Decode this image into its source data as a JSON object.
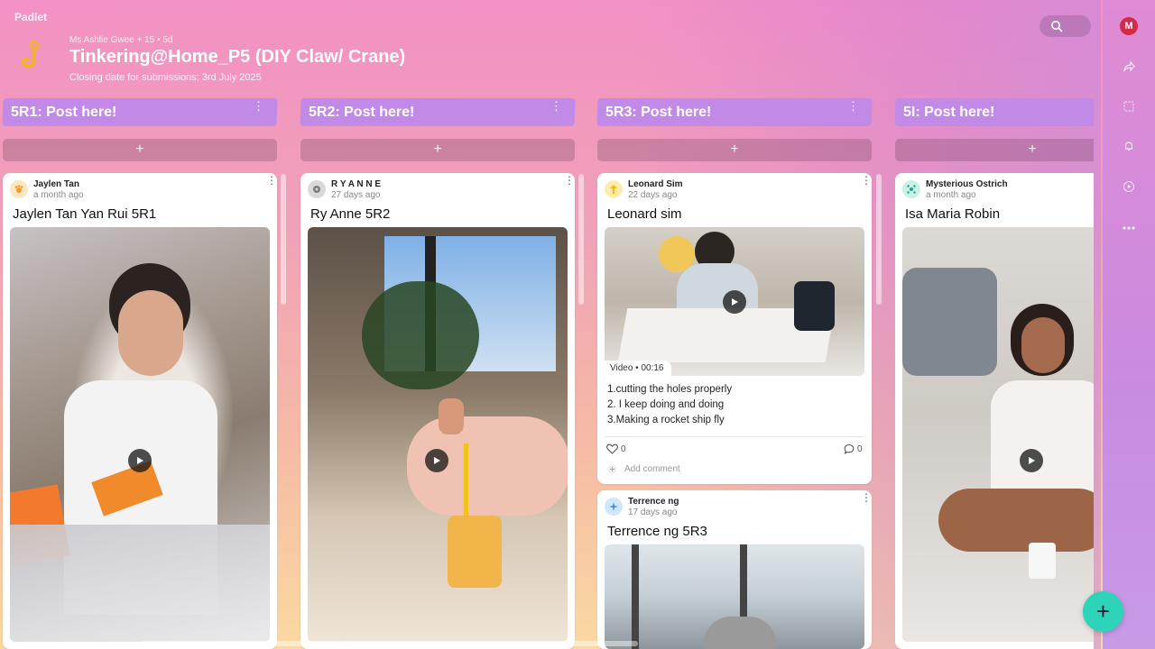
{
  "app": {
    "brand": "Padlet"
  },
  "board": {
    "meta": "Ms Ashlie Gwee + 15 • 5d",
    "title": "Tinkering@Home_P5 (DIY Claw/ Crane)",
    "subtitle": "Closing date for submissions: 3rd July 2025"
  },
  "user": {
    "avatar_letter": "M"
  },
  "add_symbol": "+",
  "columns": [
    {
      "header": "5R1: Post here!",
      "cards": [
        {
          "author": "Jaylen Tan",
          "time": "a month ago",
          "title": "Jaylen Tan Yan Rui 5R1"
        }
      ]
    },
    {
      "header": "5R2: Post here!",
      "cards": [
        {
          "author": "R Y A N N E",
          "time": "27 days ago",
          "title": "Ry Anne 5R2"
        }
      ]
    },
    {
      "header": "5R3: Post here!",
      "cards": [
        {
          "author": "Leonard Sim",
          "time": "22 days ago",
          "title": "Leonard sim",
          "video_label": "Video",
          "video_duration": "00:16",
          "body": [
            "1.cutting the holes properly",
            "2. I keep doing and doing",
            "3.Making a rocket ship fly"
          ],
          "likes": "0",
          "comments": "0",
          "add_comment": "Add comment"
        },
        {
          "author": "Terrence ng",
          "time": "17 days ago",
          "title": "Terrence ng 5R3"
        }
      ]
    },
    {
      "header": "5I: Post here!",
      "cards": [
        {
          "author": "Mysterious Ostrich",
          "time": "a month ago",
          "title": "Isa Maria Robin"
        }
      ]
    }
  ],
  "icons": [
    "search-icon",
    "share-icon",
    "slideshow-icon",
    "bell-icon",
    "play-icon",
    "more-icon",
    "heart-icon",
    "comment-icon",
    "hook-icon"
  ]
}
